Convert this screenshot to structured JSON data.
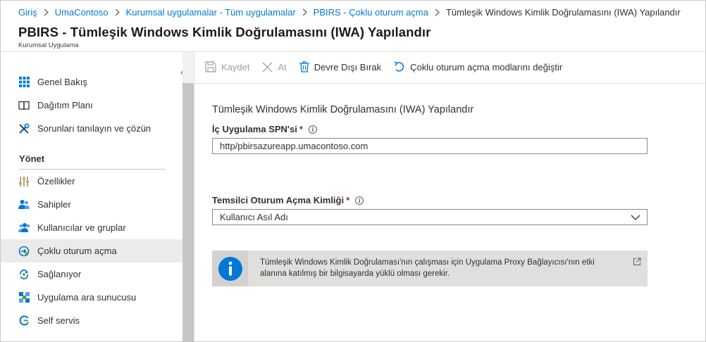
{
  "breadcrumb": [
    {
      "label": "Giriş"
    },
    {
      "label": "UmaContoso"
    },
    {
      "label": "Kurumsal uygulamalar - Tüm uygulamalar"
    },
    {
      "label": "PBIRS - Çoklu oturum açma"
    }
  ],
  "breadcrumb_current": "Tümleşik Windows Kimlik Doğrulamasını (IWA) Yapılandır",
  "header": {
    "title": "PBIRS - Tümleşik Windows Kimlik Doğrulamasını (IWA) Yapılandır",
    "subtitle": "Kurumsal Uygulama"
  },
  "sidebar": {
    "collapse_glyph": "«",
    "items_top": [
      {
        "label": "Genel Bakış",
        "icon": "grid-icon"
      },
      {
        "label": "Dağıtım Planı",
        "icon": "book-icon"
      },
      {
        "label": "Sorunları tanılayın ve çözün",
        "icon": "tools-icon"
      }
    ],
    "section_label": "Yönet",
    "items_manage": [
      {
        "label": "Özellikler",
        "icon": "sliders-icon"
      },
      {
        "label": "Sahipler",
        "icon": "users-icon"
      },
      {
        "label": "Kullanıcılar ve gruplar",
        "icon": "user-group-icon"
      },
      {
        "label": "Çoklu oturum açma",
        "icon": "sso-icon",
        "active": true
      },
      {
        "label": "Sağlanıyor",
        "icon": "provisioning-icon"
      },
      {
        "label": "Uygulama ara sunucusu",
        "icon": "proxy-icon"
      },
      {
        "label": "Self servis",
        "icon": "self-service-icon"
      }
    ]
  },
  "toolbar": {
    "save_label": "Kaydet",
    "discard_label": "At",
    "disable_label": "Devre Dışı Bırak",
    "change_mode_label": "Çoklu oturum açma modlarını değiştir"
  },
  "form": {
    "heading": "Tümleşik Windows Kimlik Doğrulamasını (IWA) Yapılandır",
    "spn_label": "İç Uygulama SPN'si",
    "spn_value": "http/pbirsazureapp.umacontoso.com",
    "delegated_label": "Temsilci Oturum Açma Kimliği",
    "delegated_value": "Kullanıcı Asıl Adı",
    "required_mark": "*",
    "info_glyph": "i"
  },
  "info_message": "Tümleşik Windows Kimlik Doğrulaması'nın çalışması için Uygulama Proxy Bağlayıcısı'nın etki alanına katılmış bir bilgisayarda yüklü olması gerekir.",
  "colors": {
    "accent": "#0078d4",
    "required": "#a4262c",
    "active_nav_bg": "#edebe9"
  }
}
